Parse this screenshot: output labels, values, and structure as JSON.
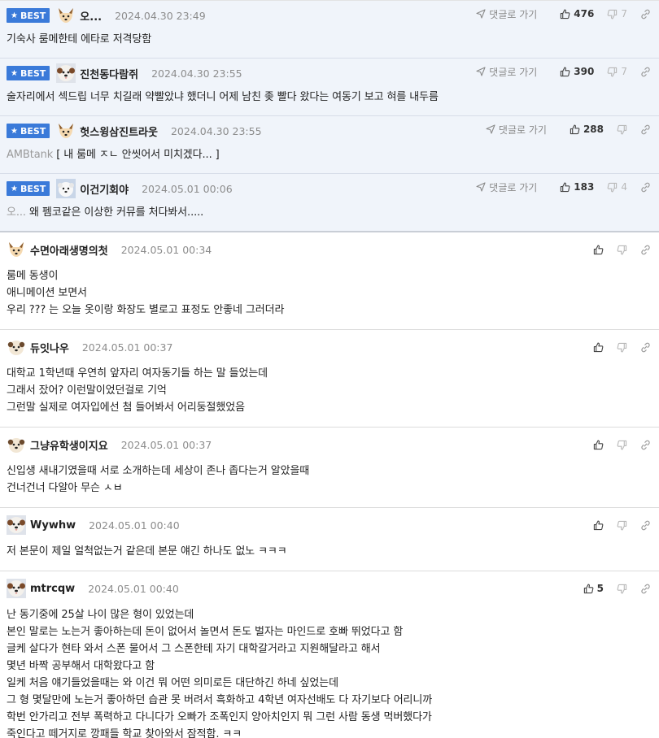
{
  "ui": {
    "best_label": "BEST",
    "reply_label": "댓글로 가기"
  },
  "comments": [
    {
      "best": true,
      "nick": "오...",
      "date": "2024.04.30 23:49",
      "prefix": "",
      "body": "기숙사 룸메한테 에타로 저격당함",
      "likes": "476",
      "dislikes": "7",
      "avatar": "fox-face"
    },
    {
      "best": true,
      "nick": "진천동다람쥐",
      "date": "2024.04.30 23:55",
      "prefix": "",
      "body": "술자리에서 섹드립 너무 치길래 약빨았냐 했더니 어제 남친 좆 빨다 왔다는 여동기 보고 혀를 내두름",
      "likes": "390",
      "dislikes": "7",
      "avatar": "fluffy-dog"
    },
    {
      "best": true,
      "nick": "헛스윙삼진트라웃",
      "date": "2024.04.30 23:55",
      "prefix": "AMBtank",
      "body": " [ 내 룸메 ㅈㄴ 안씻어서 미치겠다... ]",
      "likes": "288",
      "dislikes": "",
      "avatar": "fox-face"
    },
    {
      "best": true,
      "nick": "이건기회야",
      "date": "2024.05.01 00:06",
      "prefix": "오...",
      "body": " 왜 펨코같은 이상한 커뮤를 처다봐서.....",
      "likes": "183",
      "dislikes": "4",
      "avatar": "white-dog"
    },
    {
      "best": false,
      "nick": "수면아래생명의첫",
      "date": "2024.05.01 00:34",
      "prefix": "",
      "body": "룸메 동생이\n애니메이션 보면서\n우리 ??? 는 오늘 옷이랑 화장도 별로고 표정도 안좋네 그러더라",
      "likes": "",
      "dislikes": "",
      "avatar": "fox-face"
    },
    {
      "best": false,
      "nick": "듀잇나우",
      "date": "2024.05.01 00:37",
      "prefix": "",
      "body": "대학교 1학년때 우연히 앞자리 여자동기들 하는 말 들었는데\n그래서 잤어? 이런말이었던걸로 기억\n그런말 실제로 여자입에선 첨 들어봐서 어리둥절했었음",
      "likes": "",
      "dislikes": "",
      "avatar": "round-dog"
    },
    {
      "best": false,
      "nick": "그냥유학생이지요",
      "date": "2024.05.01 00:37",
      "prefix": "",
      "body": "신입생 새내기였을때 서로 소개하는데 세상이 존나 좁다는거 알았을때\n건너건너 다알아 무슨 ㅅㅂ",
      "likes": "",
      "dislikes": "",
      "avatar": "round-dog"
    },
    {
      "best": false,
      "nick": "Wywhw",
      "date": "2024.05.01 00:40",
      "prefix": "",
      "body": "저 본문이 제일 얼척없는거 같은데 본문 얘긴 하나도 없노 ㅋㅋㅋ",
      "likes": "",
      "dislikes": "",
      "avatar": "fluffy-dog"
    },
    {
      "best": false,
      "nick": "mtrcqw",
      "date": "2024.05.01 00:40",
      "prefix": "",
      "body": "난 동기중에 25살 나이 많은 형이 있었는데\n본인 말로는 노는거 좋아하는데 돈이 없어서 놀면서 돈도 벌자는 마인드로 호빠 뛰었다고 함\n글케 살다가 현타 와서 스폰 물어서 그 스폰한테 자기 대학갈거라고 지원해달라고 해서\n몇년 바짝 공부해서 대학왔다고 함\n일케 처음 얘기들었을때는 와 이건 뭐 어떤 의미로든 대단하긴 하네 싶었는데\n그 형 몇달만에 노는거 좋아하던 습관 못 버려서 흑화하고 4학년 여자선배도 다 자기보다 어리니까\n학번 안가리고 전부 폭력하고 다니다가 오빠가 조폭인지 양아치인지 뭐 그런 사람 동생 먹버했다가\n죽인다고 떼거지로 깡패들 학교 찾아와서 잠적함. ㅋㅋ",
      "likes": "5",
      "dislikes": "",
      "avatar": "fluffy-dog"
    }
  ]
}
